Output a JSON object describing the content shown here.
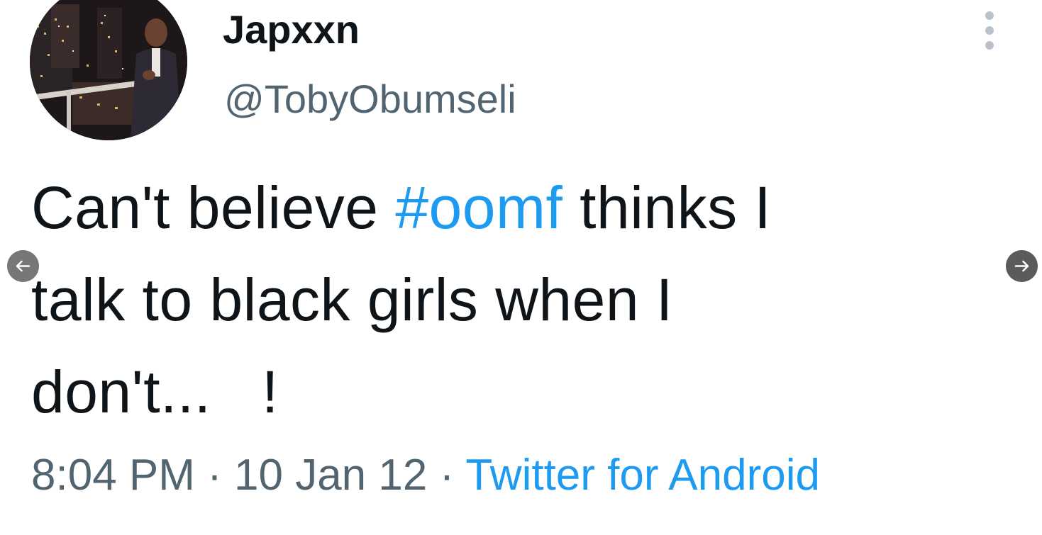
{
  "tweet": {
    "display_name": "Japxxn",
    "handle": "@TobyObumseli",
    "text": {
      "line1_before": "Can't believe ",
      "hashtag": "#oomf",
      "line1_after": " thinks I",
      "line2": "talk to black girls when I",
      "line3": "don't...   !"
    },
    "time": "8:04 PM",
    "separator": " · ",
    "date": "10 Jan 12",
    "source": "Twitter for Android"
  },
  "navigation": {
    "prev_icon": "arrow-left",
    "next_icon": "arrow-right"
  },
  "colors": {
    "accent": "#1d9bf0",
    "text": "#0f1419",
    "secondary": "#536471"
  }
}
